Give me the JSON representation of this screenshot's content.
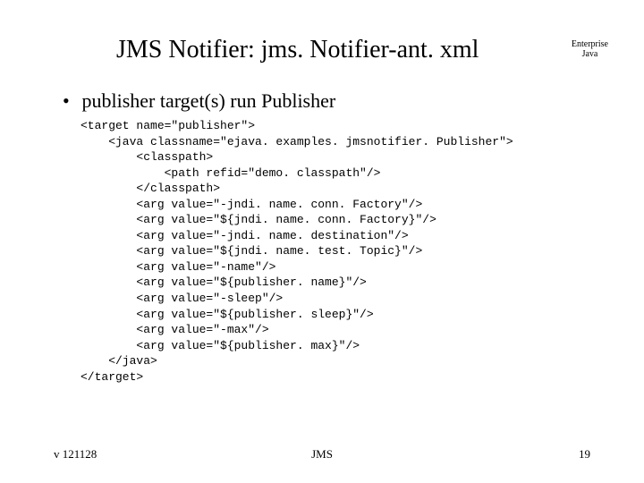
{
  "header": {
    "title": "JMS Notifier: jms. Notifier-ant. xml",
    "corner_line1": "Enterprise",
    "corner_line2": "Java"
  },
  "bullet": {
    "marker": "•",
    "text": "publisher target(s) run Publisher"
  },
  "code": {
    "l01": "<target name=\"publisher\">",
    "l02": "    <java classname=\"ejava. examples. jmsnotifier. Publisher\">",
    "l03": "        <classpath>",
    "l04": "            <path refid=\"demo. classpath\"/>",
    "l05": "        </classpath>",
    "l06": "        <arg value=\"-jndi. name. conn. Factory\"/>",
    "l07": "        <arg value=\"${jndi. name. conn. Factory}\"/>",
    "l08": "        <arg value=\"-jndi. name. destination\"/>",
    "l09": "        <arg value=\"${jndi. name. test. Topic}\"/>",
    "l10": "        <arg value=\"-name\"/>",
    "l11": "        <arg value=\"${publisher. name}\"/>",
    "l12": "        <arg value=\"-sleep\"/>",
    "l13": "        <arg value=\"${publisher. sleep}\"/>",
    "l14": "        <arg value=\"-max\"/>",
    "l15": "        <arg value=\"${publisher. max}\"/>",
    "l16": "    </java>",
    "l17": "</target>"
  },
  "footer": {
    "version": "v 121128",
    "center": "JMS",
    "page": "19"
  }
}
